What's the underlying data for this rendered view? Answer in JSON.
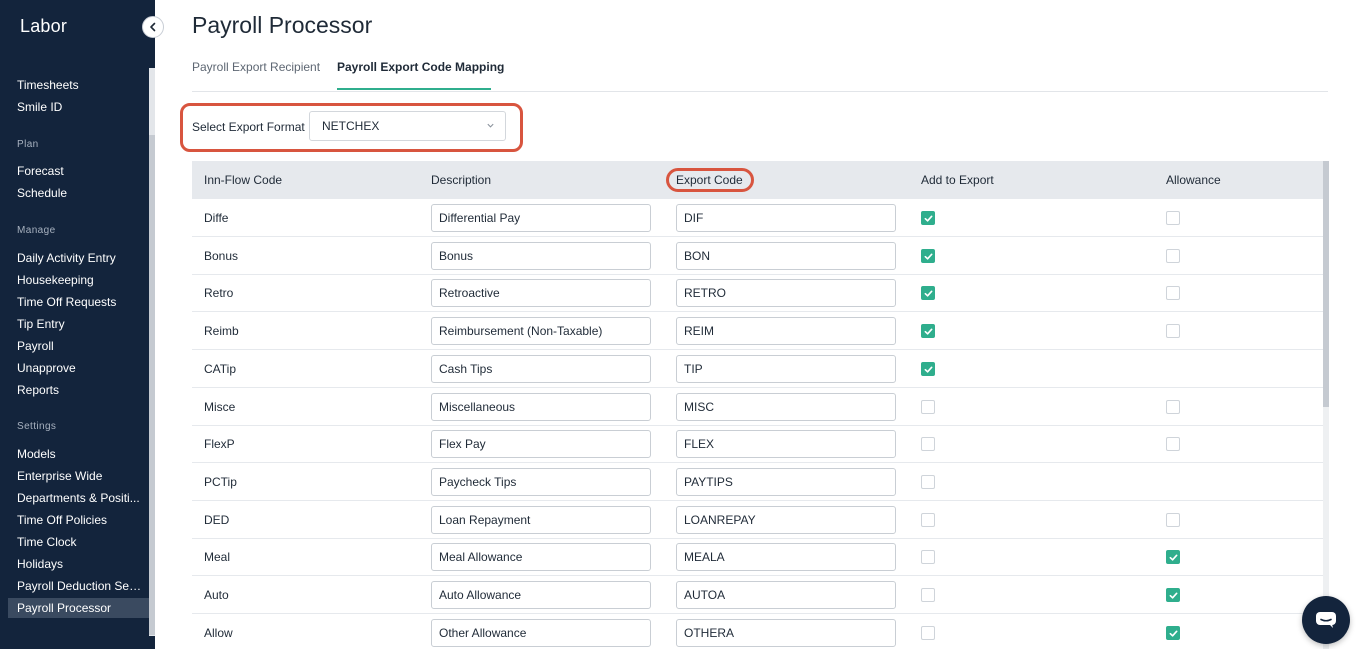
{
  "sidebar": {
    "brand": "Labor",
    "items_top": [
      "Timesheets",
      "Smile ID"
    ],
    "section_plan": "Plan",
    "items_plan": [
      "Forecast",
      "Schedule"
    ],
    "section_manage": "Manage",
    "items_manage": [
      "Daily Activity Entry",
      "Housekeeping",
      "Time Off Requests",
      "Tip Entry",
      "Payroll",
      "Unapprove",
      "Reports"
    ],
    "section_settings": "Settings",
    "items_settings": [
      "Models",
      "Enterprise Wide",
      "Departments & Positi...",
      "Time Off Policies",
      "Time Clock",
      "Holidays",
      "Payroll Deduction Sett...",
      "Payroll Processor"
    ],
    "active_item": "Payroll Processor"
  },
  "page": {
    "title": "Payroll Processor",
    "tabs": [
      "Payroll Export Recipient",
      "Payroll Export Code Mapping"
    ],
    "active_tab": "Payroll Export Code Mapping"
  },
  "export_format": {
    "label": "Select Export Format",
    "value": "NETCHEX"
  },
  "table": {
    "headers": [
      "Inn-Flow Code",
      "Description",
      "Export Code",
      "Add to Export",
      "Allowance"
    ],
    "rows": [
      {
        "code": "Diffe",
        "description": "Differential Pay",
        "export_code": "DIF",
        "add_to_export": true,
        "allowance": false
      },
      {
        "code": "Bonus",
        "description": "Bonus",
        "export_code": "BON",
        "add_to_export": true,
        "allowance": false
      },
      {
        "code": "Retro",
        "description": "Retroactive",
        "export_code": "RETRO",
        "add_to_export": true,
        "allowance": false
      },
      {
        "code": "Reimb",
        "description": "Reimbursement (Non-Taxable)",
        "export_code": "REIM",
        "add_to_export": true,
        "allowance": false
      },
      {
        "code": "CATip",
        "description": "Cash Tips",
        "export_code": "TIP",
        "add_to_export": true,
        "allowance": null
      },
      {
        "code": "Misce",
        "description": "Miscellaneous",
        "export_code": "MISC",
        "add_to_export": false,
        "allowance": false
      },
      {
        "code": "FlexP",
        "description": "Flex Pay",
        "export_code": "FLEX",
        "add_to_export": false,
        "allowance": false
      },
      {
        "code": "PCTip",
        "description": "Paycheck Tips",
        "export_code": "PAYTIPS",
        "add_to_export": false,
        "allowance": null
      },
      {
        "code": "DED",
        "description": "Loan Repayment",
        "export_code": "LOANREPAY",
        "add_to_export": false,
        "allowance": false
      },
      {
        "code": "Meal",
        "description": "Meal Allowance",
        "export_code": "MEALA",
        "add_to_export": false,
        "allowance": true
      },
      {
        "code": "Auto",
        "description": "Auto Allowance",
        "export_code": "AUTOA",
        "add_to_export": false,
        "allowance": true
      },
      {
        "code": "Allow",
        "description": "Other Allowance",
        "export_code": "OTHERA",
        "add_to_export": false,
        "allowance": true
      }
    ]
  },
  "colors": {
    "sidebar_bg": "#13243c",
    "accent": "#2fae8d",
    "highlight": "#d8553f",
    "header_bg": "#e6e9ed"
  },
  "icons": {
    "collapse": "chevron-left-icon",
    "select": "chevron-down-icon",
    "checkbox": "check-icon",
    "chat": "chat-icon"
  }
}
